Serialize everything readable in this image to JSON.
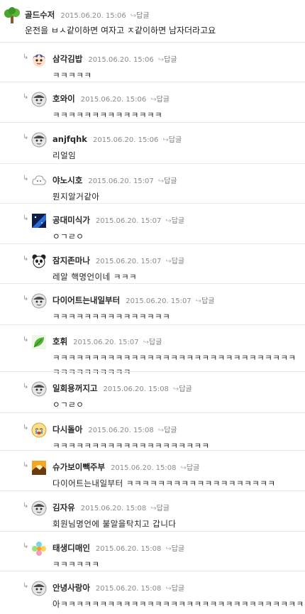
{
  "reply_glyph": "↳",
  "reply_link_label": "답글",
  "comments": [
    {
      "user": "골드수저",
      "time": "2015.06.20. 15:06",
      "text": "운전을 ㅂㅅ같이하면 여자고 ㅈ같이하면 남자더라고요",
      "avatar_icon": "tree-icon"
    },
    {
      "user": "삼각김밥",
      "time": "2015.06.20. 15:06",
      "text": "ㅋㅋㅋㅋㅋ",
      "avatar_icon": "anime-face-icon"
    },
    {
      "user": "호와이",
      "time": "2015.06.20. 15:06",
      "text": "ㅋㅋㅋㅋㅋㅋㅋㅋㅋㅋㅋㅋㅋㅋ",
      "avatar_icon": "default-face-icon"
    },
    {
      "user": "anjfqhk",
      "time": "2015.06.20. 15:06",
      "text": "리얼임",
      "avatar_icon": "default-face-icon"
    },
    {
      "user": "야노시호",
      "time": "2015.06.20. 15:07",
      "text": "뭔지알거같아",
      "avatar_icon": "cloud-icon"
    },
    {
      "user": "공대미식가",
      "time": "2015.06.20. 15:07",
      "text": "ㅇㄱㄹㅇ",
      "avatar_icon": "space-icon"
    },
    {
      "user": "잠지존마나",
      "time": "2015.06.20. 15:07",
      "text": "레알 핵명언이네 ㅋㅋㅋ",
      "avatar_icon": "panda-icon"
    },
    {
      "user": "다이어트는내일부터",
      "time": "2015.06.20. 15:07",
      "text": "ㅋㅋㅋㅋㅋㅋㅋㅋㅋㅋㅋㅋㅋㅋㅋ",
      "avatar_icon": "default-face-icon"
    },
    {
      "user": "호휘",
      "time": "2015.06.20. 15:07",
      "text": "ㅋㅋㅋㅋㅋㅋㅋㅋㅋㅋㅋㅋㅋㅋㅋㅋㅋㅋㅋㅋㅋㅋㅋㅋㅋㅋㅋㅋㅋㅋㅋㅋㅋㅋㅋㅋㅋㅋㅋㅋㅋ",
      "avatar_icon": "leaf-icon"
    },
    {
      "user": "일회용꺼지고",
      "time": "2015.06.20. 15:08",
      "text": "ㅇㄱㄹㅇ",
      "avatar_icon": "default-face-icon"
    },
    {
      "user": "다시돌아",
      "time": "2015.06.20. 15:08",
      "text": "ㅋㅋㅋㅋㅋㅋㅋㅋㅋㅋㅋㅋㅋㅋㅋㅋㅋㅋㅋㅋ",
      "avatar_icon": "crying-face-icon"
    },
    {
      "user": "슈가보이빽주부",
      "time": "2015.06.20. 15:08",
      "text": "다이어트는내일부터 ㅋㅋㅋㅋㅋㅋㅋㅋㅋㅋㅋㅋㅋㅋㅋㅋㅋㅋㅋ",
      "avatar_icon": "sunset-icon"
    },
    {
      "user": "김자유",
      "time": "2015.06.20. 15:08",
      "text": "회원님명언에 불알을탁치고 갑니다",
      "avatar_icon": "default-face-icon"
    },
    {
      "user": "태생디매인",
      "time": "2015.06.20. 15:08",
      "text": "ㅋㅋㅋㅋㅋㅋ",
      "avatar_icon": "flower-icon"
    },
    {
      "user": "안녕사랑아",
      "time": "2015.06.20. 15:08",
      "text": "아ㅋㅋㅋㅋㅋㅋㅋㅋㅋㅋㅋㅋㅋㅋㅋㅋㅋㅋㅋㅋㅋㅋㅋㅋㅋㅋㅋㅋㅋㅋㅋㅋ",
      "avatar_icon": "default-face-icon"
    }
  ]
}
